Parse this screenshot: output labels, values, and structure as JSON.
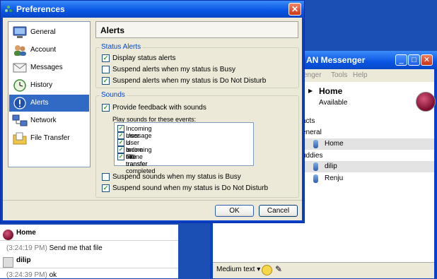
{
  "lan_window": {
    "title": "AN Messenger",
    "menu": [
      "enger",
      "Tools",
      "Help"
    ],
    "me": {
      "name": "Home",
      "status": "Available"
    },
    "contacts_header": "acts",
    "groups": [
      {
        "name": "eneral",
        "members": [
          "Home"
        ]
      },
      {
        "name": "uddies",
        "members": [
          "dilip",
          "Renju"
        ]
      }
    ],
    "font_selector": "Medium text"
  },
  "chat": {
    "messages": [
      {
        "sender": "Home",
        "time": "(3:24:19 PM)",
        "text": "Send me that file"
      },
      {
        "sender": "dilip",
        "time": "(3:24:39 PM)",
        "text": "ok"
      }
    ]
  },
  "prefs": {
    "title": "Preferences",
    "nav": [
      {
        "label": "General",
        "icon": "monitor-icon"
      },
      {
        "label": "Account",
        "icon": "users-icon"
      },
      {
        "label": "Messages",
        "icon": "envelope-icon"
      },
      {
        "label": "History",
        "icon": "clock-icon"
      },
      {
        "label": "Alerts",
        "icon": "alert-icon"
      },
      {
        "label": "Network",
        "icon": "network-icon"
      },
      {
        "label": "File Transfer",
        "icon": "folder-icon"
      }
    ],
    "selected_nav": "Alerts",
    "panel_title": "Alerts",
    "status_alerts": {
      "label": "Status Alerts",
      "options": [
        {
          "label": "Display status alerts",
          "checked": true
        },
        {
          "label": "Suspend alerts when my status is Busy",
          "checked": false
        },
        {
          "label": "Suspend alerts when my status is Do Not Disturb",
          "checked": true
        }
      ]
    },
    "sounds": {
      "label": "Sounds",
      "provide_feedback": {
        "label": "Provide feedback with sounds",
        "checked": true
      },
      "events_label": "Play sounds for these events:",
      "events": [
        {
          "label": "Incoming message",
          "checked": true
        },
        {
          "label": "User is online",
          "checked": true
        },
        {
          "label": "User is offline",
          "checked": true
        },
        {
          "label": "Incoming file transfer",
          "checked": true
        },
        {
          "label": "File transfer completed",
          "checked": true
        }
      ],
      "suspend_busy": {
        "label": "Suspend sounds when my status is Busy",
        "checked": false
      },
      "suspend_dnd": {
        "label": "Suspend sound when my status is Do Not Disturb",
        "checked": true
      }
    },
    "ok_label": "OK",
    "cancel_label": "Cancel"
  },
  "colors": {
    "xp_blue": "#0a58e6",
    "selection": "#316ac5",
    "check": "#21a121",
    "group_label": "#0046d5"
  }
}
